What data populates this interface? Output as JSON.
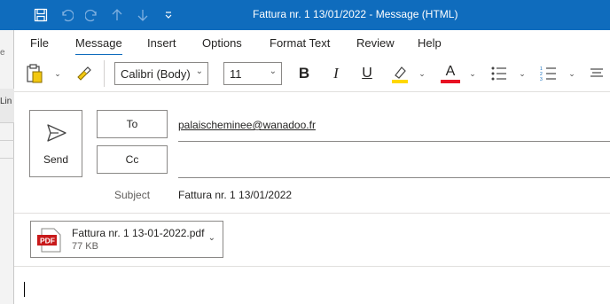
{
  "window": {
    "title": "Fattura nr. 1 13/01/2022  -  Message (HTML)"
  },
  "left_pane": {
    "fragment_top": "e",
    "fragment_col": "Lin"
  },
  "menu": {
    "items": [
      {
        "label": "File"
      },
      {
        "label": "Message"
      },
      {
        "label": "Insert"
      },
      {
        "label": "Options"
      },
      {
        "label": "Format Text"
      },
      {
        "label": "Review"
      },
      {
        "label": "Help"
      }
    ],
    "active": "Message"
  },
  "ribbon": {
    "font_name": "Calibri (Body)",
    "font_size": "11",
    "bold": "B",
    "italic": "I",
    "underline": "U",
    "font_color_letter": "A",
    "highlight_color": "#ffd800",
    "font_color": "#e81123"
  },
  "compose": {
    "send_label": "Send",
    "to_label": "To",
    "cc_label": "Cc",
    "to_value": "palaischeminee@wanadoo.fr",
    "cc_value": "",
    "subject_label": "Subject",
    "subject_value": "Fattura nr. 1 13/01/2022",
    "attachment": {
      "badge": "PDF",
      "name": "Fattura nr. 1 13-01-2022.pdf",
      "size": "77 KB"
    }
  },
  "colors": {
    "accent": "#0f6cbd",
    "pdf_red": "#c8191a"
  }
}
